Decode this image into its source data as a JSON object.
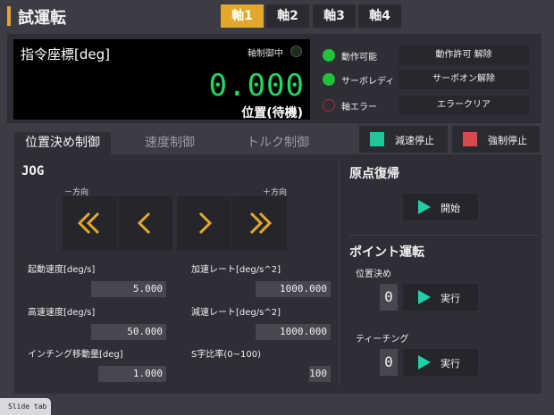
{
  "header": {
    "title": "試運転",
    "axis_tabs": [
      {
        "label": "軸1",
        "active": true
      },
      {
        "label": "軸2",
        "active": false
      },
      {
        "label": "軸3",
        "active": false
      },
      {
        "label": "軸4",
        "active": false
      }
    ]
  },
  "display": {
    "label": "指令座標[deg]",
    "axis_control_text": "軸制御中",
    "position_value": "0.000",
    "position_state": "位置(待機)"
  },
  "status": [
    {
      "text": "動作可能",
      "led": "green",
      "button": "動作許可 解除"
    },
    {
      "text": "サーボレディ",
      "led": "green",
      "button": "サーボオン解除"
    },
    {
      "text": "軸エラー",
      "led": "off",
      "button": "エラークリア"
    }
  ],
  "mode_tabs": [
    {
      "label": "位置決め制御",
      "active": true
    },
    {
      "label": "速度制御",
      "active": false
    },
    {
      "label": "トルク制御",
      "active": false
    }
  ],
  "stop_buttons": {
    "decel": {
      "label": "減速停止",
      "color": "#1dc79b"
    },
    "force": {
      "label": "強制停止",
      "color": "#d94a4f"
    }
  },
  "jog": {
    "title": "JOG",
    "minus_label": "－方向",
    "plus_label": "＋方向",
    "buttons": [
      "fast-left-icon",
      "left-icon",
      "right-icon",
      "fast-right-icon"
    ]
  },
  "params": {
    "start_speed": {
      "label": "起動速度[deg/s]",
      "value": "5.000"
    },
    "accel_rate": {
      "label": "加速レート[deg/s^2]",
      "value": "1000.000"
    },
    "high_speed": {
      "label": "高速速度[deg/s]",
      "value": "50.000"
    },
    "decel_rate": {
      "label": "減速レート[deg/s^2]",
      "value": "1000.000"
    },
    "inching": {
      "label": "インチング移動量[deg]",
      "value": "1.000"
    },
    "s_curve": {
      "label": "S字比率(0~100)",
      "value": "100"
    }
  },
  "homing": {
    "title": "原点復帰",
    "start_label": "開始"
  },
  "point": {
    "title": "ポイント運転",
    "positioning_label": "位置決め",
    "positioning_value": "0",
    "positioning_exec": "実行",
    "teaching_label": "ティーチング",
    "teaching_value": "0",
    "teaching_exec": "実行"
  },
  "slide_tab": "Slide tab",
  "colors": {
    "accent": "#e3a82b",
    "display_value": "#22d860",
    "led_green": "#21c23a",
    "led_error": "#b8252b",
    "play": "#1bd3a6"
  }
}
